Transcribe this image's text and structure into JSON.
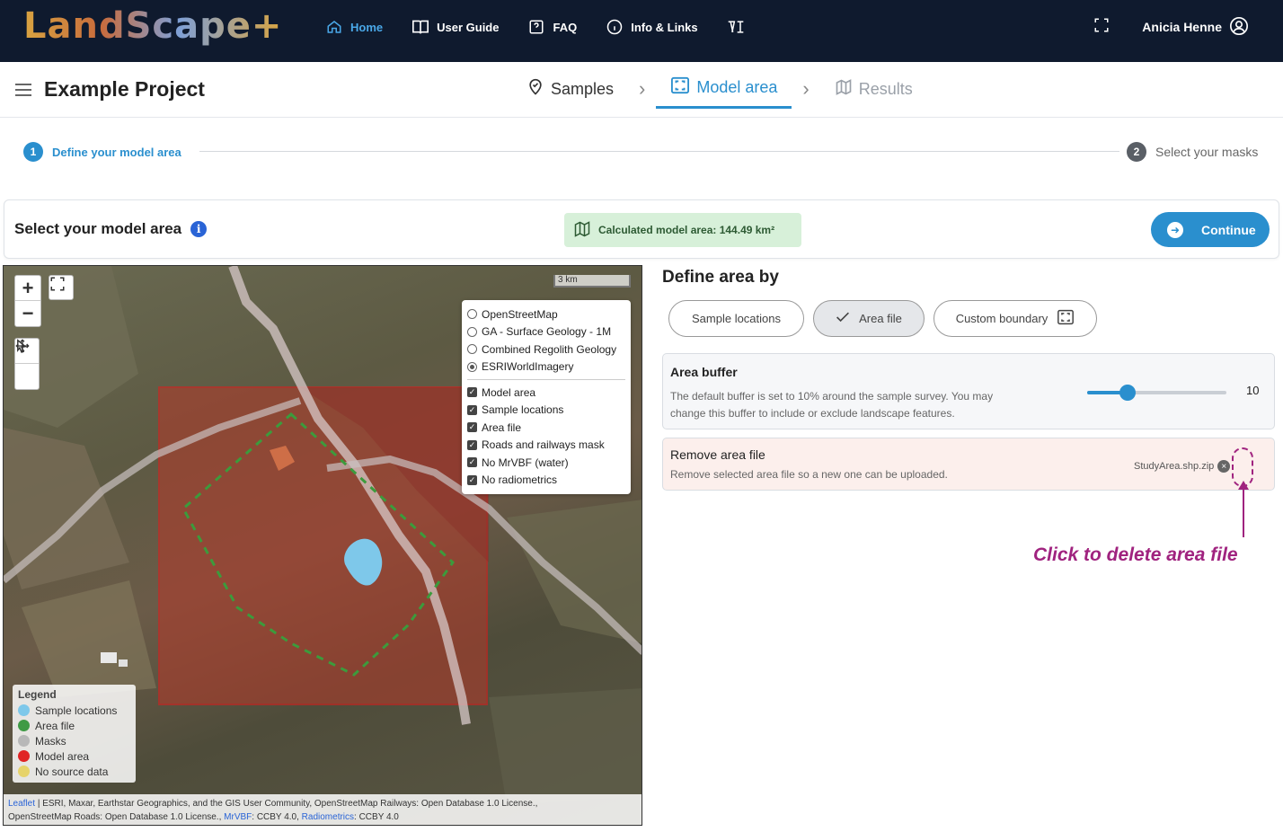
{
  "app": {
    "logo_text": "LandScape+",
    "nav": [
      {
        "label": "Home",
        "icon": "home-icon",
        "active": true
      },
      {
        "label": "User Guide",
        "icon": "book-icon"
      },
      {
        "label": "FAQ",
        "icon": "question-icon"
      },
      {
        "label": "Info & Links",
        "icon": "info-icon"
      }
    ],
    "user_name": "Anicia Henne"
  },
  "project": {
    "title": "Example Project",
    "tabs": [
      {
        "label": "Samples",
        "state": "done"
      },
      {
        "label": "Model area",
        "state": "active"
      },
      {
        "label": "Results",
        "state": "disabled"
      }
    ]
  },
  "stepper": {
    "step1": {
      "num": "1",
      "label": "Define your model area"
    },
    "step2": {
      "num": "2",
      "label": "Select your masks"
    }
  },
  "area_bar": {
    "title": "Select your model area",
    "calculated_label": "Calculated model area: 144.49 km²",
    "continue_label": "Continue"
  },
  "map": {
    "scale_label": "3 km",
    "base_layers": [
      {
        "label": "OpenStreetMap",
        "selected": false
      },
      {
        "label": "GA - Surface Geology - 1M",
        "selected": false
      },
      {
        "label": "Combined Regolith Geology",
        "selected": false
      },
      {
        "label": "ESRIWorldImagery",
        "selected": true
      }
    ],
    "overlays": [
      {
        "label": "Model area",
        "checked": true
      },
      {
        "label": "Sample locations",
        "checked": true
      },
      {
        "label": "Area file",
        "checked": true
      },
      {
        "label": "Roads and railways mask",
        "checked": true
      },
      {
        "label": "No MrVBF (water)",
        "checked": true
      },
      {
        "label": "No radiometrics",
        "checked": true
      }
    ],
    "legend": {
      "title": "Legend",
      "items": [
        {
          "label": "Sample locations",
          "color": "#7ec8ea"
        },
        {
          "label": "Area file",
          "color": "#3f9a45"
        },
        {
          "label": "Masks",
          "color": "#b8b8b8"
        },
        {
          "label": "Model area",
          "color": "#e02424"
        },
        {
          "label": "No source data",
          "color": "#e6d36a"
        }
      ]
    },
    "attribution": {
      "leaflet": "Leaflet",
      "line1_rest": "| ESRI, Maxar, Earthstar Geographics, and the GIS User Community, OpenStreetMap Railways: Open Database 1.0 License.,",
      "line2_start": "OpenStreetMap Roads: Open Database 1.0 License.,",
      "mrvbf": "MrVBF",
      "mrvbf_rest": ": CCBY 4.0,",
      "radiometrics": "Radiometrics",
      "radiometrics_rest": ": CCBY 4.0"
    }
  },
  "define": {
    "title": "Define area by",
    "options": [
      {
        "label": "Sample locations",
        "selected": false
      },
      {
        "label": "Area file",
        "selected": true
      },
      {
        "label": "Custom boundary",
        "selected": false
      }
    ],
    "buffer": {
      "title": "Area buffer",
      "desc_line1": "The default buffer is set to 10% around the sample survey. You may",
      "desc_line2": "change this buffer to include or exclude landscape features.",
      "value": "10",
      "fraction": 0.29
    },
    "remove": {
      "title": "Remove area file",
      "desc": "Remove selected area file so a new one can be uploaded.",
      "file_name": "StudyArea.shp.zip"
    }
  },
  "annotation": {
    "text": "Click to delete area file"
  },
  "colors": {
    "nav_bg": "#0f1a2e",
    "accent": "#2a8fce",
    "annotation": "#a0237f"
  }
}
